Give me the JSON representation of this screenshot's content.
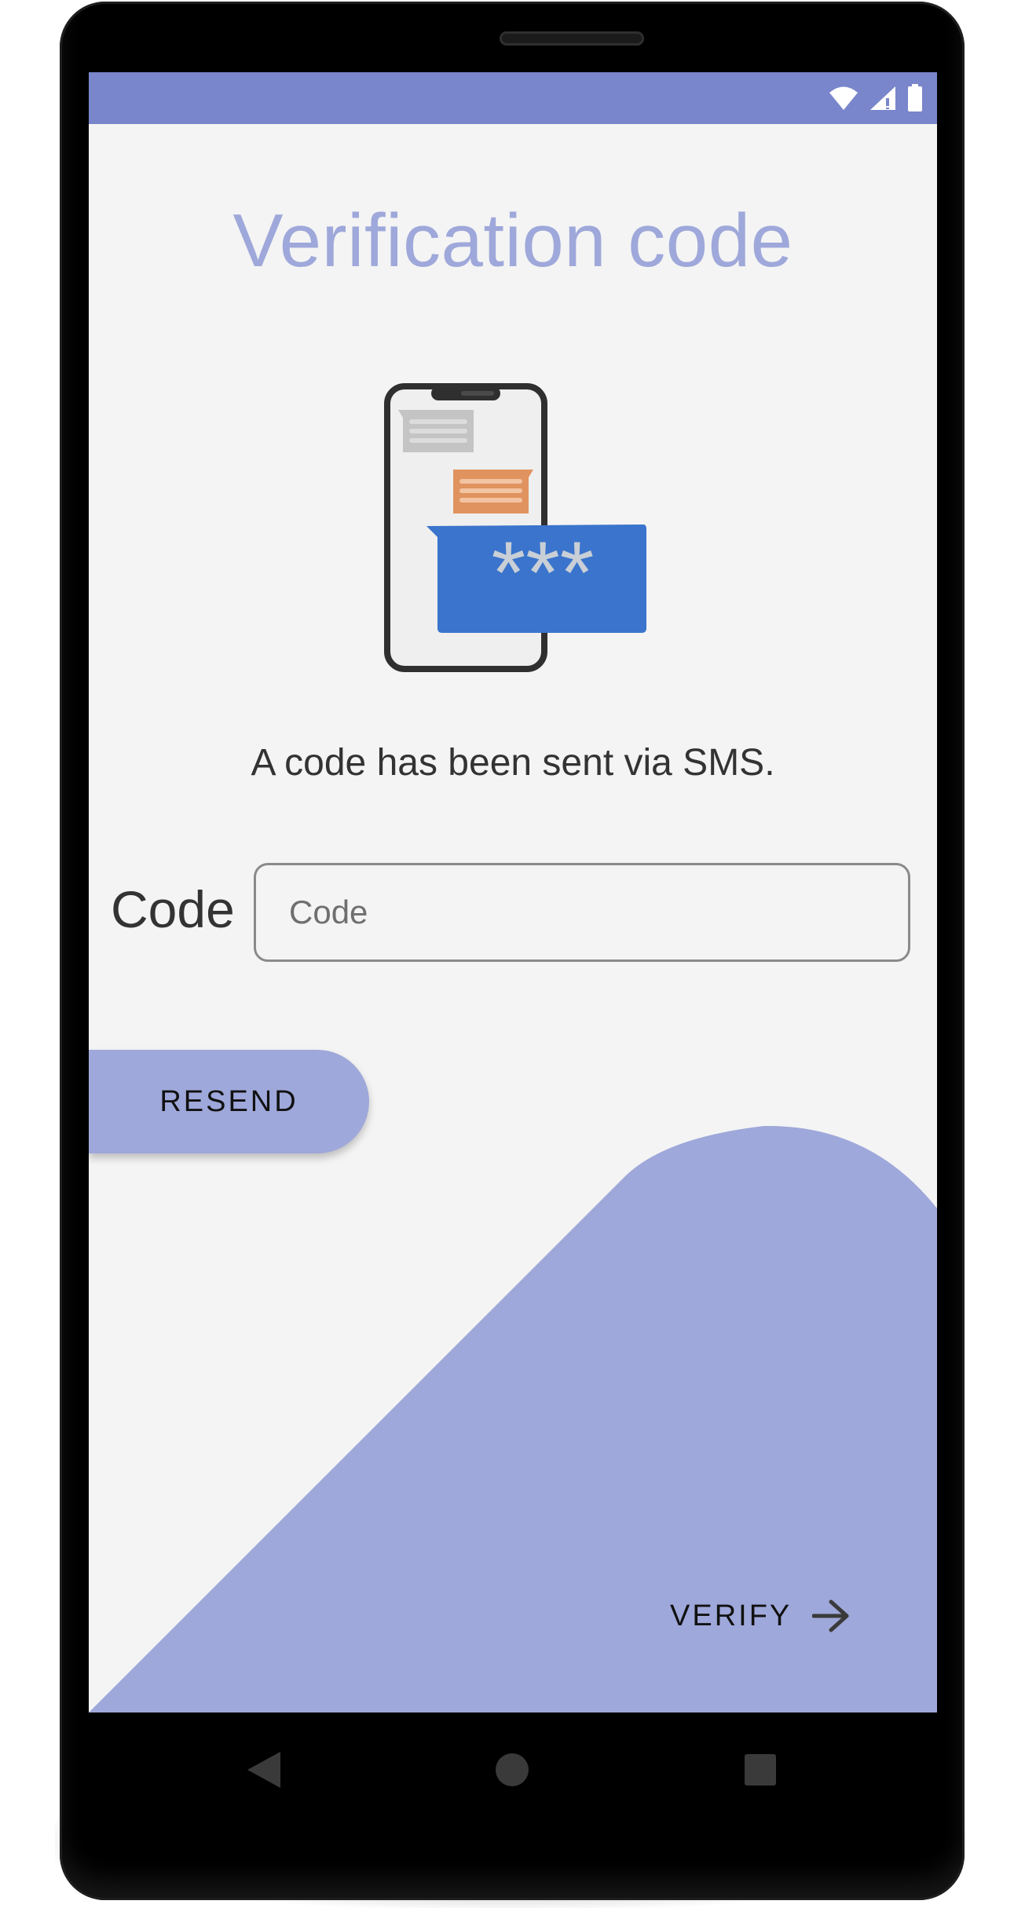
{
  "screen": {
    "title": "Verification code",
    "message": "A code has been sent via SMS.",
    "code_label": "Code",
    "code_input": {
      "value": "",
      "placeholder": "Code"
    },
    "resend_label": "RESEND",
    "verify_label": "VERIFY",
    "illustration": {
      "bubble_text": "***"
    }
  },
  "status_bar": {
    "icons": [
      "wifi-icon",
      "cell-signal-icon",
      "battery-icon"
    ]
  },
  "nav_bar": {
    "icons": [
      "back-icon",
      "home-icon",
      "recents-icon"
    ]
  },
  "colors": {
    "primary": "#7986cb",
    "primary_light": "#9fa8da",
    "background": "#f4f4f4",
    "bubble_blue": "#3a74cc",
    "bubble_orange": "#e0935e"
  }
}
